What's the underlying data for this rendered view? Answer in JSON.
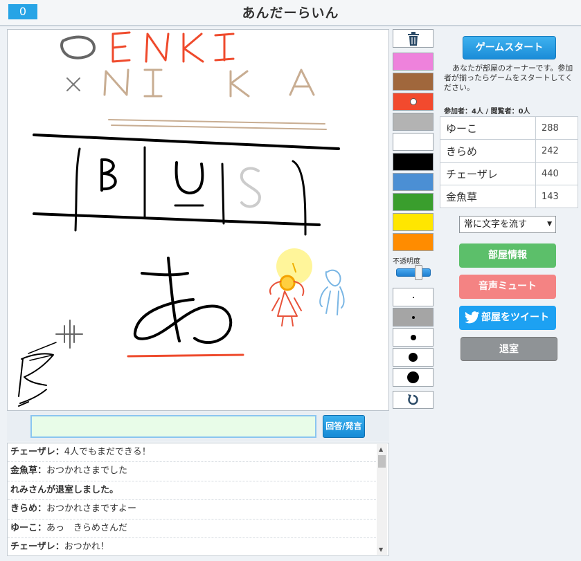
{
  "header": {
    "score": "0",
    "title": "あんだーらいん"
  },
  "palette": {
    "colors": [
      "#ee82dc",
      "#a0673c",
      "#f24a2e",
      "#b3b3b3",
      "#ffffff",
      "#000000",
      "#4b8fd4",
      "#3a9e2d",
      "#ffe600",
      "#ff8c00"
    ],
    "selected_index": 2,
    "opacity_label": "不透明度",
    "opacity_value": 0.7,
    "brush_sizes": [
      2,
      4,
      8,
      13,
      17
    ],
    "selected_brush_index": 1
  },
  "sidebar": {
    "start_button": "ゲームスタート",
    "owner_note": "あなたが部屋のオーナーです。参加者が揃ったらゲームをスタートしてください。",
    "count_line": "参加者：4人 / 閲覧者：0人",
    "players": [
      {
        "name": "ゆーこ",
        "score": "288"
      },
      {
        "name": "きらめ",
        "score": "242"
      },
      {
        "name": "チェーザレ",
        "score": "440"
      },
      {
        "name": "金魚草",
        "score": "143"
      }
    ],
    "mode_select": "常に文字を流す",
    "room_info_button": "部屋情報",
    "mute_button": "音声ミュート",
    "tweet_button": "部屋をツイート",
    "leave_button": "退室"
  },
  "answer": {
    "input_value": "",
    "submit_label": "回答/発言"
  },
  "chat": [
    {
      "name": "チェーザレ",
      "sep": "：",
      "text": "4人でもまだできる！"
    },
    {
      "name": "金魚草",
      "sep": "：",
      "text": "おつかれさまでした"
    },
    {
      "name": "れみさんが退室しました。",
      "sep": "",
      "text": ""
    },
    {
      "name": "きらめ",
      "sep": "：",
      "text": "おつかれさまですよー"
    },
    {
      "name": "ゆーこ",
      "sep": "：",
      "text": "あっ　きらめさんだ"
    },
    {
      "name": "チェーザレ",
      "sep": "：",
      "text": "おつかれ！"
    }
  ]
}
